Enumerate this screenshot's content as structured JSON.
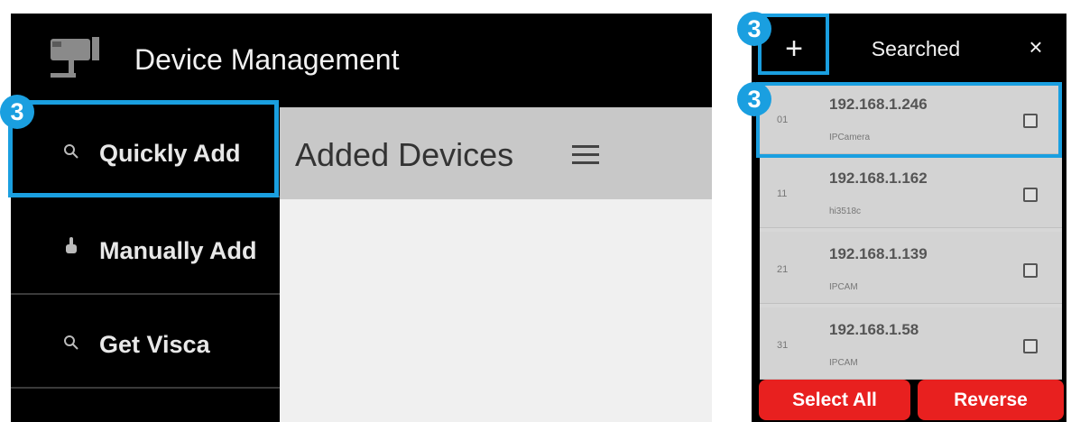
{
  "left_panel": {
    "header": {
      "title": "Device Management",
      "icon": "camera-icon"
    },
    "sidebar": [
      {
        "label": "Quickly Add",
        "icon": "search-icon"
      },
      {
        "label": "Manually Add",
        "icon": "hand-pointer-icon"
      },
      {
        "label": "Get Visca",
        "icon": "search-icon"
      }
    ],
    "content": {
      "title": "Added Devices",
      "menu_icon": "hamburger-menu-icon"
    }
  },
  "right_panel": {
    "header": {
      "add_label": "+",
      "title": "Searched",
      "close_label": "×"
    },
    "devices": [
      {
        "index": "01",
        "ip": "192.168.1.246",
        "name": "IPCamera"
      },
      {
        "index": "11",
        "ip": "192.168.1.162",
        "name": "hi3518c"
      },
      {
        "index": "21",
        "ip": "192.168.1.139",
        "name": "IPCAM"
      },
      {
        "index": "31",
        "ip": "192.168.1.58",
        "name": "IPCAM"
      }
    ],
    "buttons": {
      "select_all": "Select All",
      "reverse": "Reverse"
    }
  },
  "annotations": {
    "step_badge": "3"
  },
  "colors": {
    "accent_highlight": "#1a9fe0",
    "button_red": "#e8201f",
    "header_bg": "#000000",
    "list_bg": "#d3d3d3"
  }
}
